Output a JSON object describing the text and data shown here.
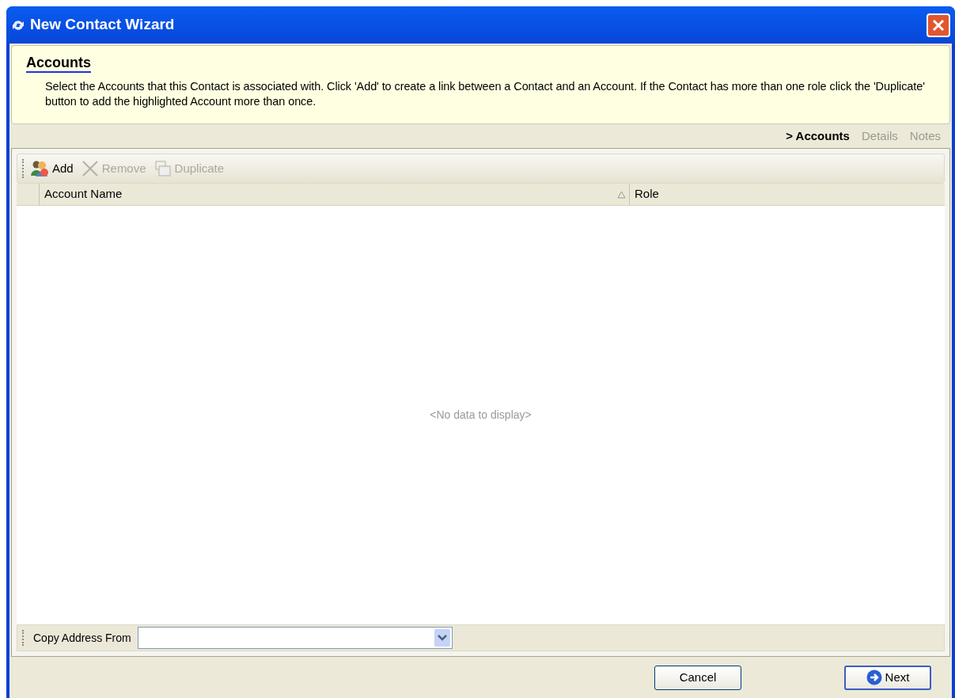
{
  "window": {
    "title": "New Contact Wizard"
  },
  "header": {
    "title": "Accounts",
    "description": "Select the Accounts that this Contact is associated with. Click 'Add' to create a link between a Contact and an Account. If the Contact has more than one role click the 'Duplicate' button to add the highlighted Account more than once."
  },
  "steps": [
    {
      "label": "> Accounts",
      "selected": true
    },
    {
      "label": "Details",
      "selected": false
    },
    {
      "label": "Notes",
      "selected": false
    }
  ],
  "toolbar": [
    {
      "kind": "add",
      "label": "Add",
      "disabled": false
    },
    {
      "kind": "remove",
      "label": "Remove",
      "disabled": true
    },
    {
      "kind": "duplicate",
      "label": "Duplicate",
      "disabled": true
    }
  ],
  "table": {
    "columns": [
      {
        "label": "Account Name",
        "sorted": true
      },
      {
        "label": "Role",
        "sorted": false
      }
    ],
    "empty_text": "<No data to display>"
  },
  "copy_address": {
    "label": "Copy Address From"
  },
  "buttons": [
    {
      "kind": "cancel",
      "label": "Cancel"
    },
    {
      "kind": "next",
      "label": "Next"
    }
  ]
}
